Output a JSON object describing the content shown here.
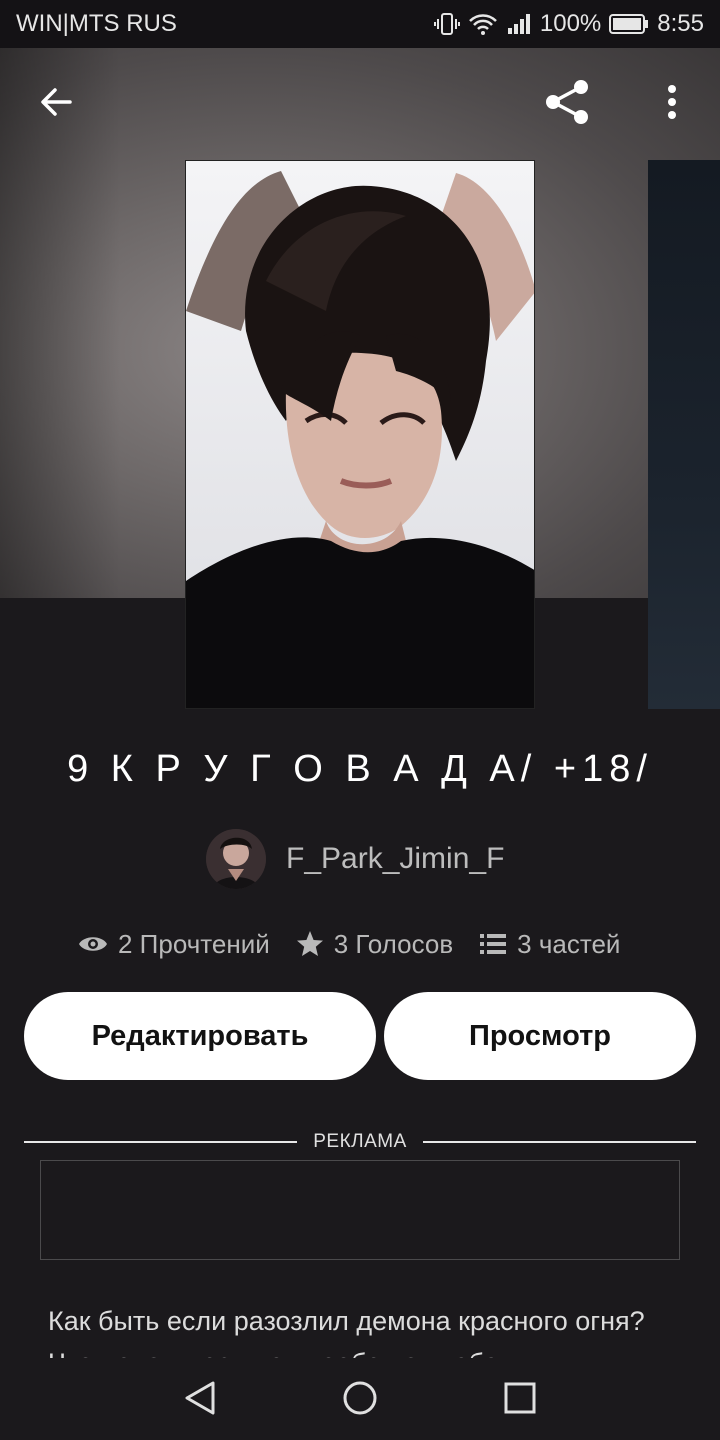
{
  "status_bar": {
    "carrier": "WIN|MTS RUS",
    "battery": "100%",
    "time": "8:55",
    "icons": [
      "vibrate-icon",
      "wifi-icon",
      "signal-icon",
      "battery-icon"
    ]
  },
  "toolbar": {
    "icons": [
      "back-arrow-icon",
      "share-icon",
      "more-vert-icon"
    ]
  },
  "story": {
    "title": "9 К Р У Г О В   А Д А/ +18/",
    "author": "F_Park_Jimin_F",
    "stats": {
      "reads": "2 Прочтений",
      "votes": "3 Голосов",
      "parts": "3 частей"
    },
    "edit_label": "Редактировать",
    "view_label": "Просмотр",
    "description": "Как быть если разозлил демона красного огня? Что делать, если он пообещал тебе"
  },
  "ad": {
    "label": "РЕКЛАМА"
  },
  "navbar": {
    "icons": [
      "nav-back-icon",
      "nav-home-icon",
      "nav-recent-icon"
    ]
  },
  "colors": {
    "background": "#1b191c",
    "status_bar": "#141215",
    "button_bg": "#ffffff",
    "button_text": "#121212",
    "muted_text": "#b9b9b9"
  }
}
